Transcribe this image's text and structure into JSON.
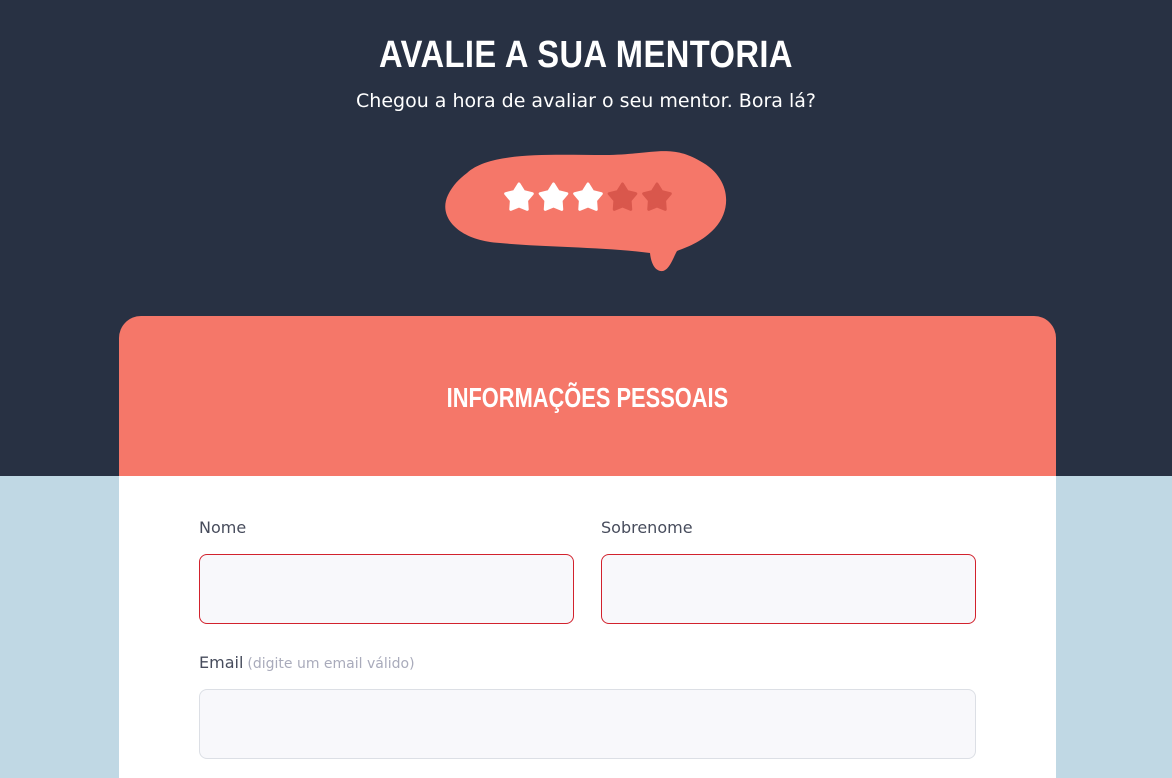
{
  "header": {
    "title": "AVALIE A SUA MENTORIA",
    "subtitle": "Chegou a hora de avaliar o seu mentor. Bora lá?"
  },
  "rating": {
    "value": 3,
    "max": 5,
    "bubble_color": "#f57769",
    "filled_star_color": "#ffffff",
    "empty_star_color": "#d9574c"
  },
  "section": {
    "title": "INFORMAÇÕES PESSOAIS"
  },
  "form": {
    "first_name": {
      "label": "Nome",
      "value": "",
      "state": "error"
    },
    "last_name": {
      "label": "Sobrenome",
      "value": "",
      "state": "error"
    },
    "email": {
      "label": "Email",
      "hint": "(digite um email válido)",
      "value": ""
    }
  },
  "colors": {
    "hero_background": "#283143",
    "page_background": "#c0d8e4",
    "accent": "#f57769",
    "error_border": "#d2222d"
  }
}
